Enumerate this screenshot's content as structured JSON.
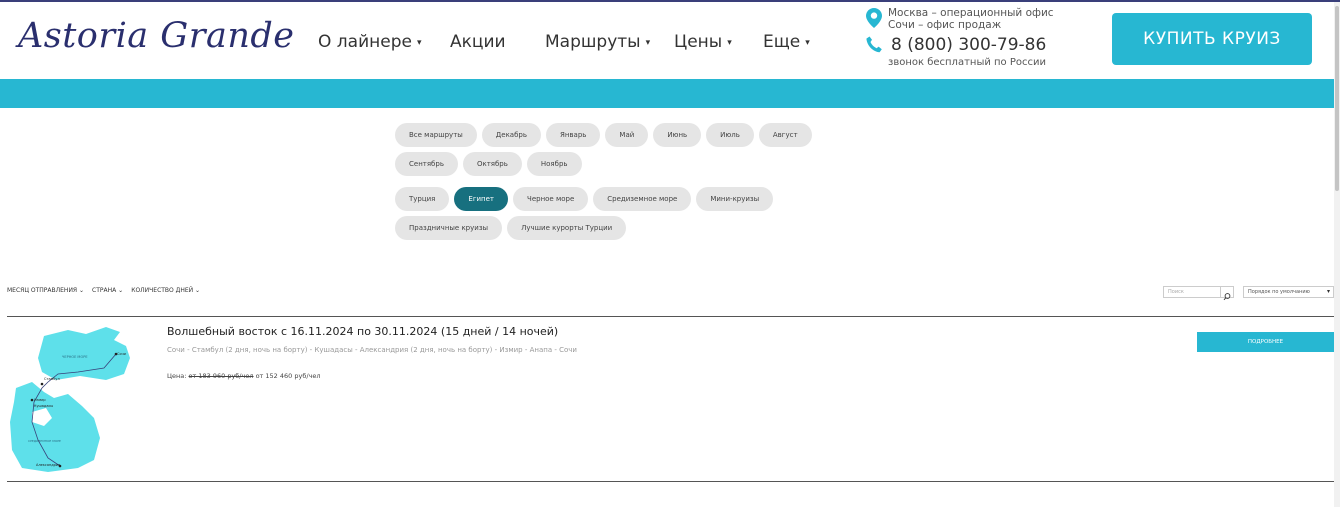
{
  "header": {
    "logo": "Astoria Grande",
    "nav": [
      {
        "label": "О лайнере",
        "dropdown": true
      },
      {
        "label": "Акции",
        "dropdown": false
      },
      {
        "label": "Маршруты",
        "dropdown": true
      },
      {
        "label": "Цены",
        "dropdown": true
      },
      {
        "label": "Еще",
        "dropdown": true
      }
    ],
    "caret": "▾",
    "contacts": {
      "office_moscow": "Москва – операционный офис",
      "office_sochi": "Сочи – офис продаж",
      "phone": "8 (800) 300-79-86",
      "phone_note": "звонок бесплатный по России",
      "pin_icon": "location-pin-icon",
      "phone_icon": "phone-icon",
      "icon_color": "#27b7d2"
    },
    "buy_label": "КУПИТЬ КРУИЗ"
  },
  "colors": {
    "accent": "#27b7d2",
    "active_chip": "#17707f",
    "logo": "#2a2f6e"
  },
  "month_chips": [
    "Все маршруты",
    "Декабрь",
    "Январь",
    "Май",
    "Июнь",
    "Июль",
    "Август",
    "Сентябрь",
    "Октябрь",
    "Ноябрь"
  ],
  "region_chips": [
    {
      "label": "Турция",
      "active": false
    },
    {
      "label": "Египет",
      "active": true
    },
    {
      "label": "Черное море",
      "active": false
    },
    {
      "label": "Средиземное море",
      "active": false
    },
    {
      "label": "Мини-круизы",
      "active": false
    },
    {
      "label": "Праздничные круизы",
      "active": false
    },
    {
      "label": "Лучшие курорты Турции",
      "active": false
    }
  ],
  "filters": {
    "items": [
      "МЕСЯЦ ОТПРАВЛЕНИЯ ⌄",
      "СТРАНА ⌄",
      "КОЛИЧЕСТВО ДНЕЙ ⌄"
    ],
    "search_placeholder": "Поиск",
    "search_icon": "search-icon",
    "sort_value": "Порядок по умолчанию",
    "sort_caret": "▾"
  },
  "cruise": {
    "title": "Волшебный восток с 16.11.2024 по 30.11.2024 (15 дней / 14 ночей)",
    "route": "Сочи - Стамбул (2 дня, ночь на борту) - Кушадасы - Александрия (2 дня, ночь на борту) - Измир - Анапа - Сочи",
    "price_label": "Цена:",
    "price_old": "от 183 960 руб/чел",
    "price_new": "от 152 460 руб/чел",
    "more_label": "ПОДРОБНЕЕ",
    "map_labels": [
      "ЧЕРНОЕ МОРЕ",
      "Сочи",
      "Стамбул",
      "Кушадасы",
      "Измир",
      "СРЕДИЗЕМНОЕ МОРЕ",
      "Александрия"
    ],
    "map_icon": "route-map-image"
  }
}
